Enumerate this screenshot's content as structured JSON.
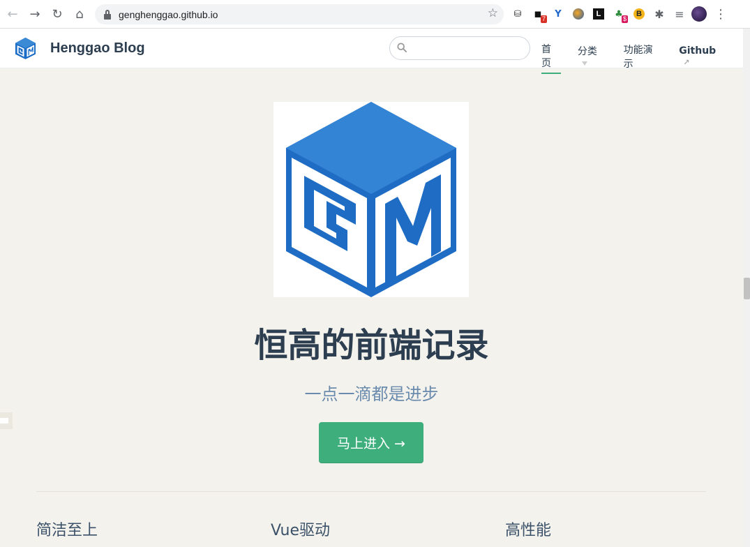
{
  "browser": {
    "url": "genghenggao.github.io",
    "extensions": [
      {
        "name": "coins-extension-icon",
        "glyph": "⚙"
      },
      {
        "name": "ghost-extension-icon",
        "glyph": "◼",
        "badge": "7"
      },
      {
        "name": "y-extension-icon",
        "glyph": "Y"
      },
      {
        "name": "fox-extension-icon",
        "glyph": "●"
      },
      {
        "name": "square-l-extension-icon",
        "glyph": "L"
      },
      {
        "name": "dollar-extension-icon",
        "glyph": "♣",
        "badge": "$"
      },
      {
        "name": "b-extension-icon",
        "glyph": "B"
      },
      {
        "name": "puzzle-extension-icon",
        "glyph": "✱"
      },
      {
        "name": "playlist-icon",
        "glyph": "≡"
      }
    ]
  },
  "site": {
    "name": "Henggao Blog",
    "search_placeholder": "",
    "nav": {
      "home": "首页",
      "category": "分类",
      "demo": "功能演示",
      "github": "Github"
    }
  },
  "hero": {
    "title": "恒高的前端记录",
    "description": "一点一滴都是进步",
    "action": "马上进入 →"
  },
  "features": [
    {
      "title": "简洁至上"
    },
    {
      "title": "Vue驱动"
    },
    {
      "title": "高性能"
    }
  ],
  "colors": {
    "accent": "#3eaf7c",
    "logo_blue": "#1a6cc7",
    "logo_light_blue": "#3a8ad6",
    "page_bg": "#f4f2ec"
  }
}
